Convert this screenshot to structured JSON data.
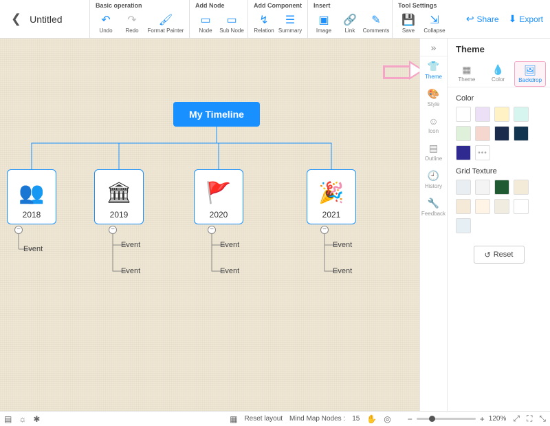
{
  "doc": {
    "title": "Untitled"
  },
  "toolbar": {
    "groups": {
      "basic": {
        "label": "Basic operation",
        "undo": "Undo",
        "redo": "Redo",
        "format_painter": "Format Painter"
      },
      "add_node": {
        "label": "Add Node",
        "node": "Node",
        "sub_node": "Sub Node"
      },
      "add_component": {
        "label": "Add Component",
        "relation": "Relation",
        "summary": "Summary"
      },
      "insert": {
        "label": "Insert",
        "image": "Image",
        "link": "Link",
        "comments": "Comments"
      },
      "tool_settings": {
        "label": "Tool Settings",
        "save": "Save",
        "collapse": "Collapse"
      }
    },
    "share": "Share",
    "export": "Export"
  },
  "mindmap": {
    "root": "My Timeline",
    "years": [
      "2018",
      "2019",
      "2020",
      "2021"
    ],
    "event_label": "Event"
  },
  "side_strip": {
    "theme": "Theme",
    "style": "Style",
    "icon": "Icon",
    "outline": "Outline",
    "history": "History",
    "feedback": "Feedback"
  },
  "panel": {
    "title": "Theme",
    "tabs": {
      "theme": "Theme",
      "color": "Color",
      "backdrop": "Backdrop"
    },
    "color_section": "Color",
    "grid_section": "Grid Texture",
    "reset": "Reset",
    "colors_row1": [
      "#ffffff",
      "#ece0f7",
      "#fff2c4",
      "#d6f5ef",
      "#dff0db"
    ],
    "colors_row2": [
      "#f6d7d0",
      "#1b2b4b",
      "#12344f",
      "#2e2a8f",
      "more"
    ],
    "textures": [
      "#e8eef2",
      "#f4f4f4",
      "#1f5a32",
      "#f3ead8",
      "#f5ead8",
      "#fff4e6",
      "#f1ece0",
      "#ffffff",
      "#e6f0f4"
    ]
  },
  "statusbar": {
    "reset_layout": "Reset layout",
    "nodes_label": "Mind Map Nodes :",
    "nodes_count": "15",
    "zoom": "120%"
  }
}
